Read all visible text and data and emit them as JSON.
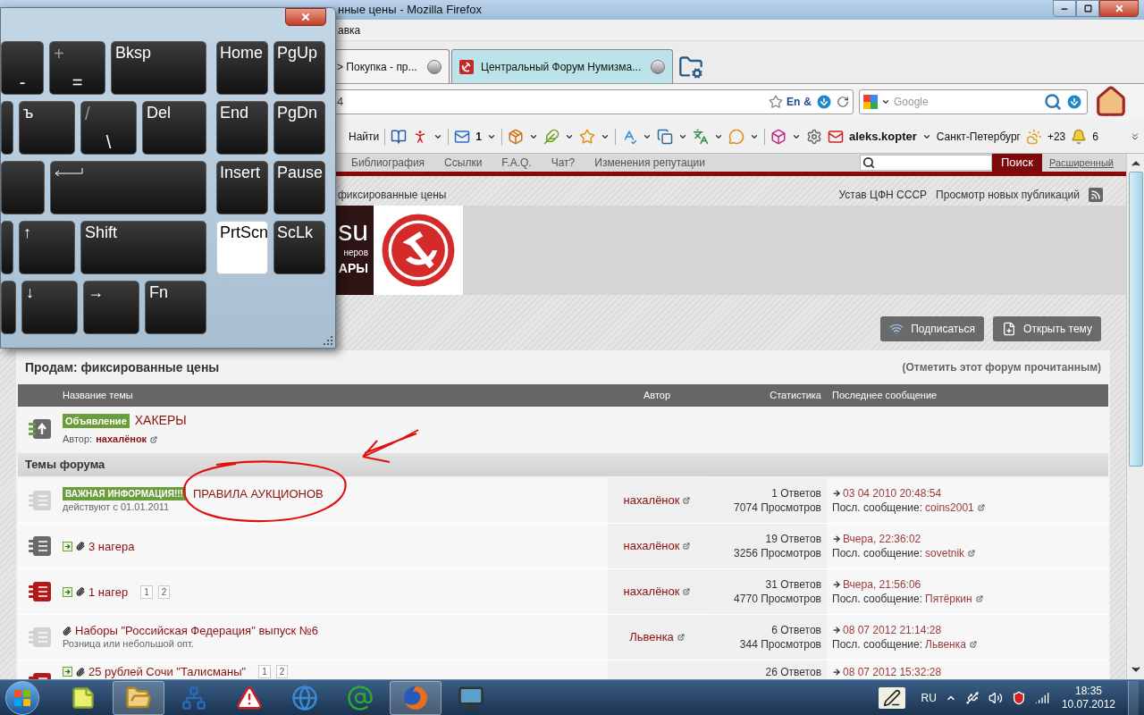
{
  "browser": {
    "title": "нные цены - Mozilla Firefox",
    "menu": [
      "авка"
    ],
    "tabs": [
      {
        "label": "> Покупка - пр...",
        "selected": false
      },
      {
        "label": "Центральный Форум Нумизма...",
        "selected": true
      }
    ],
    "address": {
      "value": "4",
      "badges": [
        "En",
        "&"
      ]
    },
    "search": {
      "placeholder": "Google"
    },
    "toolbar": {
      "find": "Найти",
      "mail_count": "1",
      "user": "aleks.kopter",
      "city": "Санкт-Петербург",
      "temperature": "+23",
      "count": "6"
    }
  },
  "keyboard": {
    "main_rows": [
      [
        {
          "kind": "char",
          "label": "-",
          "pressed": false
        },
        {
          "kind": "char",
          "shift": "+",
          "label": "=",
          "pressed": false
        },
        {
          "kind": "name",
          "label": "Bksp",
          "pressed": false
        }
      ],
      [
        {
          "kind": "blank",
          "pressed": false
        },
        {
          "kind": "name",
          "label": "ъ",
          "pressed": false
        },
        {
          "kind": "char",
          "shift": "/",
          "label": "\\",
          "pressed": false
        },
        {
          "kind": "name",
          "label": "Del",
          "pressed": false
        }
      ],
      [
        {
          "kind": "blank",
          "pressed": false
        },
        {
          "kind": "enter",
          "pressed": false
        }
      ],
      [
        {
          "kind": "blank",
          "pressed": false
        },
        {
          "kind": "name",
          "label": "↑",
          "pressed": false
        },
        {
          "kind": "name",
          "label": "Shift",
          "pressed": false
        }
      ],
      [
        {
          "kind": "blank",
          "pressed": false
        },
        {
          "kind": "name",
          "label": "↓",
          "pressed": false
        },
        {
          "kind": "name",
          "label": "→",
          "pressed": false
        },
        {
          "kind": "name",
          "label": "Fn",
          "pressed": false
        }
      ]
    ],
    "nav_keys": [
      {
        "label": "Home",
        "pressed": false
      },
      {
        "label": "PgUp",
        "pressed": false
      },
      {
        "label": "End",
        "pressed": false
      },
      {
        "label": "PgDn",
        "pressed": false
      },
      {
        "label": "Insert",
        "pressed": false
      },
      {
        "label": "Pause",
        "pressed": false
      },
      {
        "label": "PrtScn",
        "pressed": true
      },
      {
        "label": "ScLk",
        "pressed": false
      }
    ]
  },
  "site": {
    "nav": [
      "Библиография",
      "Ссылки",
      "F.A.Q.",
      "Чат?",
      "Изменения репутации"
    ],
    "search_button": "Поиск",
    "advanced_link": "Расширенный",
    "breadcrumb": "фиксированные цены",
    "links": [
      "Устав ЦФН СССР",
      "Просмотр новых публикаций"
    ],
    "banner": {
      "big": "su",
      "small": "неров",
      "bold": "АРЫ"
    },
    "buttons": [
      {
        "kind": "subscribe",
        "label": "Подписаться"
      },
      {
        "kind": "new",
        "label": "Открыть тему"
      }
    ]
  },
  "forum": {
    "title": "Продам: фиксированные цены",
    "mark_read": "(Отметить этот форум прочитанным)",
    "columns": [
      "Название темы",
      "Автор",
      "Статистика",
      "Последнее сообщение"
    ],
    "announcement": {
      "badge": "Объявление",
      "title": "ХАКЕРЫ",
      "author_label": "Автор:",
      "author": "нахалёнок"
    },
    "section": "Темы форума",
    "topics": [
      {
        "kind": "faded",
        "new": false,
        "attachment": false,
        "badge": "ВАЖНАЯ ИНФОРМАЦИЯ!!!",
        "title": "ПРАВИЛА АУКЦИОНОВ",
        "subtitle": "действуют с 01.01.2011",
        "author": "нахалёнок",
        "replies": "1 Ответов",
        "views": "7074 Просмотров",
        "last_date": "03 04 2010 20:48:54",
        "last_label": "Посл. сообщение:",
        "last_user": "coins2001"
      },
      {
        "kind": "normal",
        "new": true,
        "attachment": true,
        "title": "3 нагера",
        "author": "нахалёнок",
        "replies": "19 Ответов",
        "views": "3256 Просмотров",
        "last_date": "Вчера, 22:36:02",
        "last_label": "Посл. сообщение:",
        "last_user": "sovetnik"
      },
      {
        "kind": "hot",
        "new": true,
        "attachment": true,
        "title": "1 нагер",
        "pages": [
          "1",
          "2"
        ],
        "author": "нахалёнок",
        "replies": "31 Ответов",
        "views": "4770 Просмотров",
        "last_date": "Вчера, 21:56:06",
        "last_label": "Посл. сообщение:",
        "last_user": "Пятёркин"
      },
      {
        "kind": "faded",
        "new": false,
        "attachment": true,
        "title": "Наборы \"Российская Федерация\" выпуск №6",
        "subtitle": "Розница или небольшой опт.",
        "author": "Львенка",
        "replies": "6 Ответов",
        "views": "344 Просмотров",
        "last_date": "08 07 2012 21:14:28",
        "last_label": "Посл. сообщение:",
        "last_user": "Львенка"
      },
      {
        "kind": "hot",
        "new": true,
        "attachment": true,
        "title": "25 рублей Сочи \"Талисманы\"",
        "pages": [
          "1",
          "2"
        ],
        "replies": "26 Ответов",
        "last_date": "08 07 2012 15:32:28"
      }
    ]
  },
  "taskbar": {
    "apps": [
      {
        "kind": "notes",
        "selected": false
      },
      {
        "kind": "explorer",
        "selected": true
      },
      {
        "kind": "diagram",
        "selected": false
      },
      {
        "kind": "warning",
        "selected": false
      },
      {
        "kind": "globe",
        "selected": false
      },
      {
        "kind": "mail",
        "selected": false
      },
      {
        "kind": "firefox",
        "selected": true
      },
      {
        "kind": "monitor",
        "selected": false
      }
    ],
    "language": "RU",
    "time": "18:35",
    "date": "10.07.2012"
  }
}
